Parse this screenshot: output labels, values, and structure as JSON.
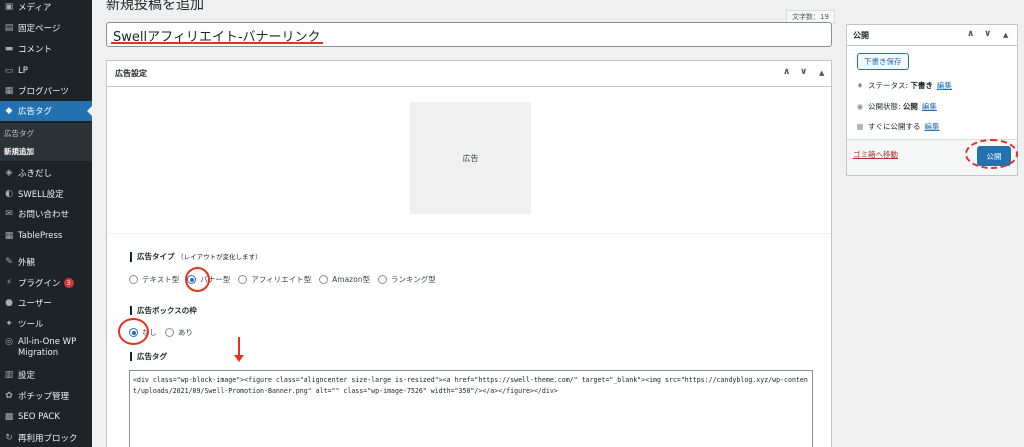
{
  "sidebar": {
    "items": [
      {
        "icon": "media-icon",
        "glyph": "▣",
        "label": "メディア"
      },
      {
        "icon": "page-icon",
        "glyph": "▤",
        "label": "固定ページ"
      },
      {
        "icon": "comment-icon",
        "glyph": "▬",
        "label": "コメント"
      },
      {
        "icon": "lp-icon",
        "glyph": "▭",
        "label": "LP"
      },
      {
        "icon": "blockparts-icon",
        "glyph": "▦",
        "label": "ブログパーツ"
      },
      {
        "icon": "ad-tag-icon",
        "glyph": "◆",
        "label": "広告タグ"
      },
      {
        "icon": "fukidashi-icon",
        "glyph": "◈",
        "label": "ふきだし"
      },
      {
        "icon": "swell-icon",
        "glyph": "◐",
        "label": "SWELL設定"
      },
      {
        "icon": "mail-icon",
        "glyph": "✉",
        "label": "お問い合わせ"
      },
      {
        "icon": "table-icon",
        "glyph": "▦",
        "label": "TablePress"
      },
      {
        "icon": "appearance-icon",
        "glyph": "✎",
        "label": "外観"
      },
      {
        "icon": "plugin-icon",
        "glyph": "⚡",
        "label": "プラグイン",
        "badge": "3"
      },
      {
        "icon": "user-icon",
        "glyph": "●",
        "label": "ユーザー"
      },
      {
        "icon": "tool-icon",
        "glyph": "✦",
        "label": "ツール"
      },
      {
        "icon": "migration-icon",
        "glyph": "◎",
        "label": "All-in-One WP",
        "label2": "Migration"
      },
      {
        "icon": "settings-icon",
        "glyph": "▥",
        "label": "設定"
      },
      {
        "icon": "pochipp-icon",
        "glyph": "✿",
        "label": "ポチップ管理"
      },
      {
        "icon": "seo-icon",
        "glyph": "▩",
        "label": "SEO PACK"
      },
      {
        "icon": "reuse-block-icon",
        "glyph": "↻",
        "label": "再利用ブロック"
      }
    ],
    "submenu": [
      "広告タグ",
      "新規追加"
    ]
  },
  "page_title": "新規投稿を追加",
  "char_count": "文字数：19",
  "post_title": "Swellアフィリエイト-バナーリンク",
  "ad_settings": {
    "header": "広告設定",
    "preview_label": "広告",
    "ad_type_label": "広告タイプ",
    "ad_type_note": "（レイアウトが変化します）",
    "ad_types": [
      "テキスト型",
      "バナー型",
      "アフィリエイト型",
      "Amazon型",
      "ランキング型"
    ],
    "ad_type_selected": "バナー型",
    "box_border_label": "広告ボックスの枠",
    "box_border_options": [
      "なし",
      "あり"
    ],
    "box_border_selected": "なし",
    "ad_tag_label": "広告タグ",
    "ad_tag_code": "<div class=\"wp-block-image\"><figure class=\"aligncenter size-large is-resized\"><a href=\"https://swell-theme.com/\" target=\"_blank\"><img src=\"https://candyblog.xyz/wp-content/uploads/2021/09/Swell-Promotion-Banner.png\" alt=\"\" class=\"wp-image-7526\" width=\"350\"/></a></figure></div>"
  },
  "publish": {
    "header": "公開",
    "save_draft": "下書き保存",
    "status_label": "ステータス:",
    "status_value": "下書き",
    "visibility_label": "公開状態:",
    "visibility_value": "公開",
    "schedule_label": "すぐに公開する",
    "edit_label": "編集",
    "trash_label": "ゴミ箱へ移動",
    "publish_button": "公開"
  },
  "colors": {
    "accent": "#2271b1",
    "annotation": "#e5331c",
    "sidebar": "#1d2327"
  }
}
